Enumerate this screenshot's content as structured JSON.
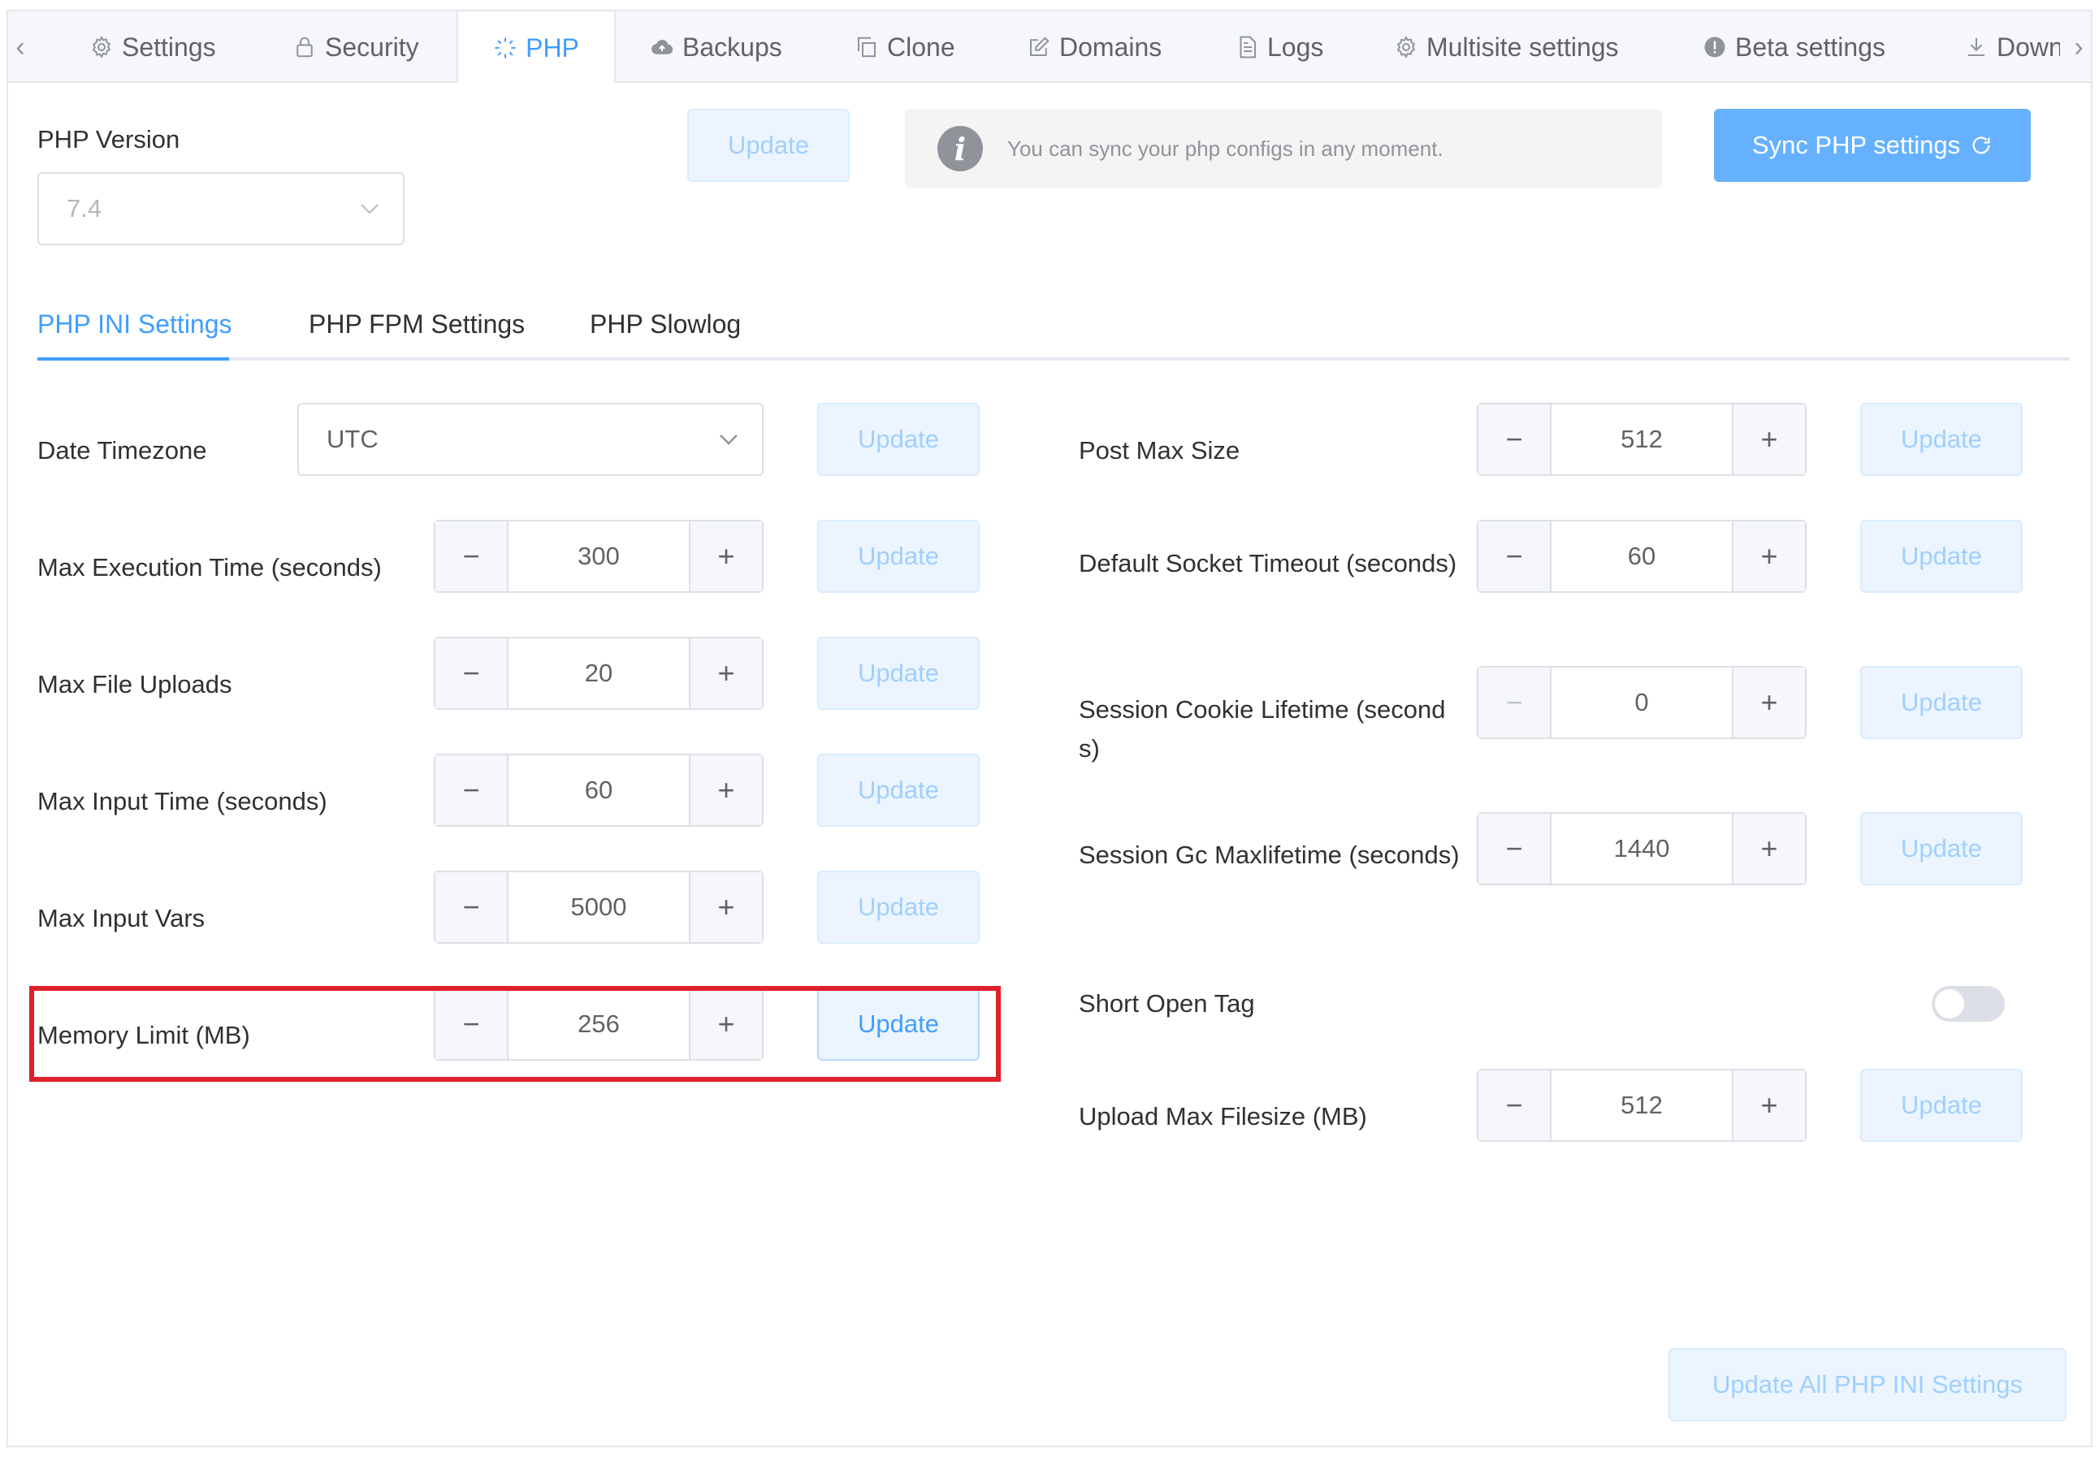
{
  "top_tabs": [
    {
      "label": "Settings",
      "icon": "gear-icon"
    },
    {
      "label": "Security",
      "icon": "lock-icon"
    },
    {
      "label": "PHP",
      "icon": "spinner-icon"
    },
    {
      "label": "Backups",
      "icon": "cloud-icon"
    },
    {
      "label": "Clone",
      "icon": "copy-icon"
    },
    {
      "label": "Domains",
      "icon": "edit-icon"
    },
    {
      "label": "Logs",
      "icon": "document-icon"
    },
    {
      "label": "Multisite settings",
      "icon": "gear-icon"
    },
    {
      "label": "Beta settings",
      "icon": "warning-icon"
    },
    {
      "label": "Down",
      "icon": "download-icon"
    }
  ],
  "php_version": {
    "label": "PHP Version",
    "value": "7.4",
    "update_label": "Update"
  },
  "alert": {
    "message": "You can sync your php configs in any moment."
  },
  "sync_button": {
    "label": "Sync PHP settings"
  },
  "sub_tabs": [
    {
      "label": "PHP INI Settings"
    },
    {
      "label": "PHP FPM Settings"
    },
    {
      "label": "PHP Slowlog"
    }
  ],
  "left": {
    "timezone": {
      "label": "Date Timezone",
      "value": "UTC",
      "update": "Update"
    },
    "rows": [
      {
        "label": "Max Execution Time (seconds)",
        "value": "300",
        "update": "Update"
      },
      {
        "label": "Max File Uploads",
        "value": "20",
        "update": "Update"
      },
      {
        "label": "Max Input Time (seconds)",
        "value": "60",
        "update": "Update"
      },
      {
        "label": "Max Input Vars",
        "value": "5000",
        "update": "Update"
      },
      {
        "label": "Memory Limit (MB)",
        "value": "256",
        "update": "Update"
      }
    ]
  },
  "right": {
    "rows": [
      {
        "label": "Post Max Size",
        "value": "512",
        "update": "Update"
      },
      {
        "label": "Default Socket Timeout (seconds)",
        "value": "60",
        "update": "Update"
      },
      {
        "label": "Session Cookie Lifetime (seconds)",
        "value": "0",
        "update": "Update"
      },
      {
        "label": "Session Gc Maxlifetime (seconds)",
        "value": "1440",
        "update": "Update"
      }
    ],
    "short_open_tag": {
      "label": "Short Open Tag",
      "enabled": false
    },
    "upload": {
      "label": "Upload Max Filesize (MB)",
      "value": "512",
      "update": "Update"
    }
  },
  "update_all": {
    "label": "Update All PHP INI Settings"
  },
  "stepper_symbols": {
    "minus": "−",
    "plus": "+"
  },
  "colors": {
    "accent": "#409eff",
    "highlight": "#e0202a"
  }
}
